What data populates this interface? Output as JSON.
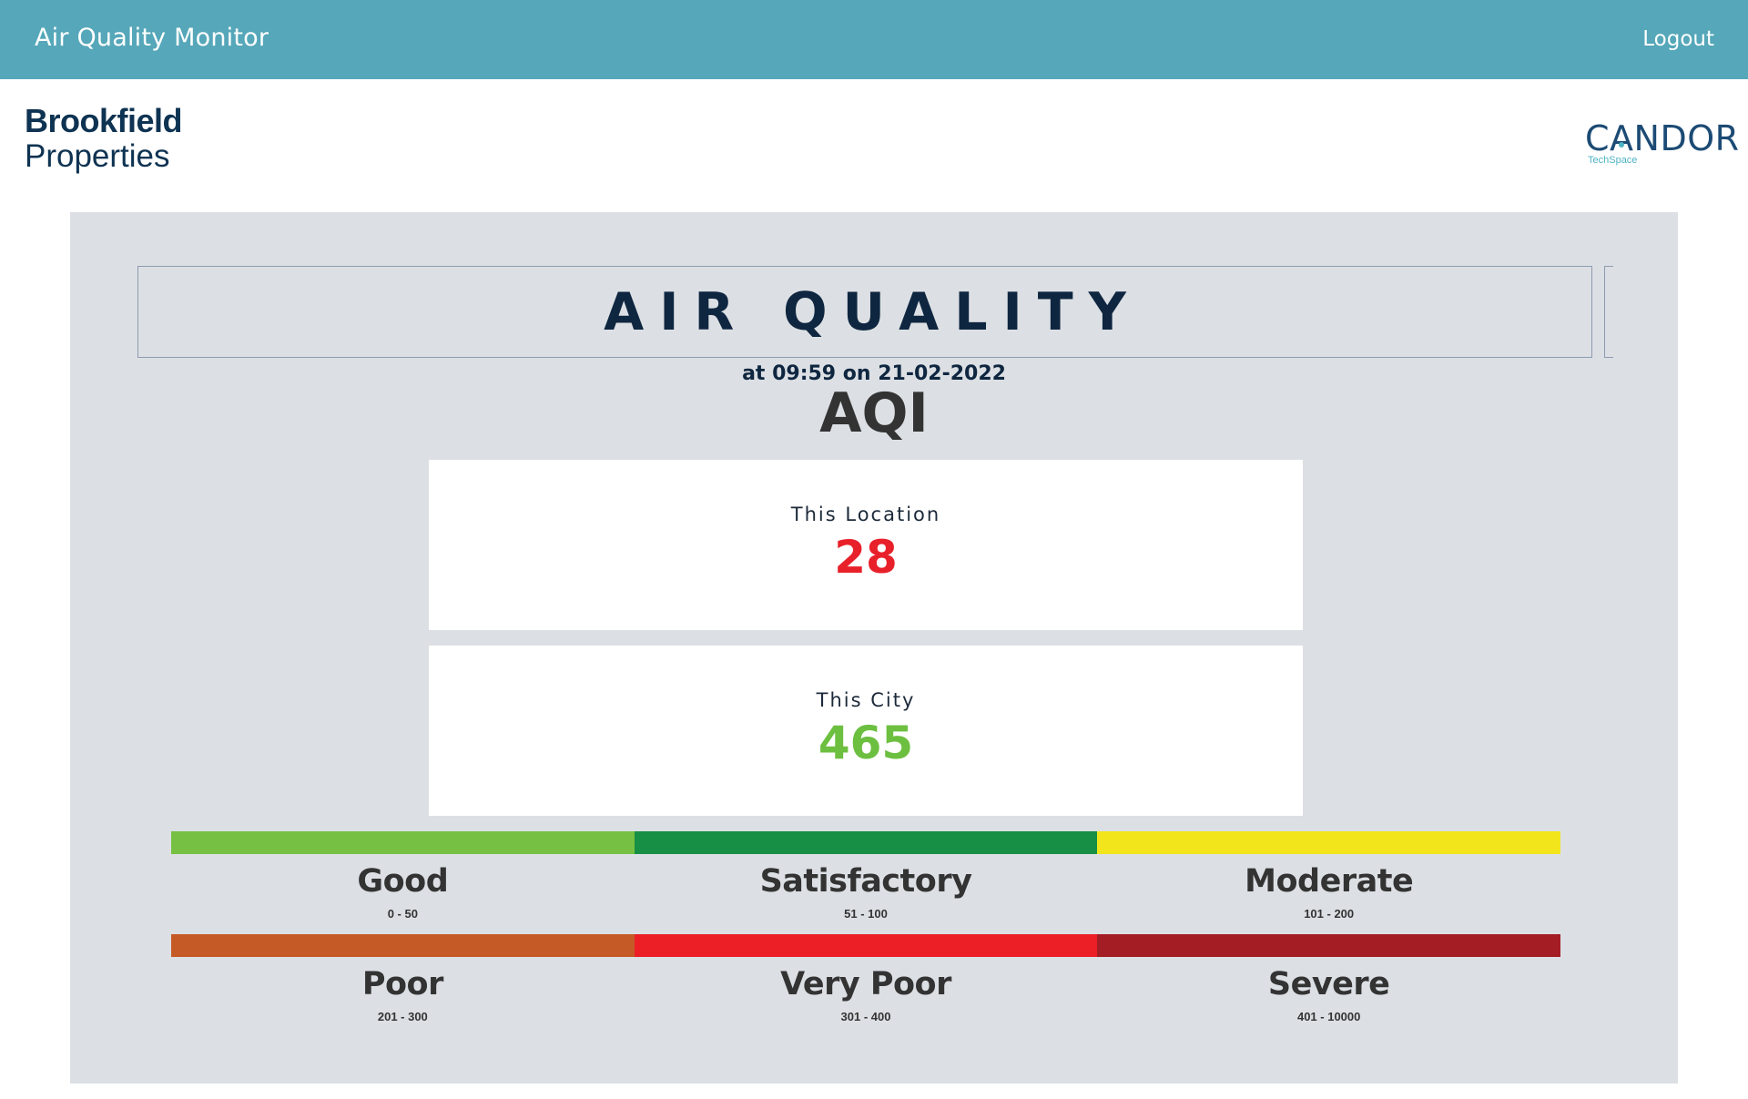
{
  "header": {
    "app_title": "Air Quality Monitor",
    "logout_label": "Logout",
    "background_color": "#55a7b9"
  },
  "brand_left": {
    "line1": "Brookfield",
    "line2": "Properties"
  },
  "brand_right": {
    "name_part1": "C",
    "name_accent": "A",
    "name_part2": "NDOR",
    "tagline": "TechSpace"
  },
  "main": {
    "title": "AIR QUALITY",
    "timestamp": "at 09:59 on 21-02-2022",
    "aqi_heading": "AQI",
    "cards": [
      {
        "label": "This Location",
        "value": "28",
        "color": "#e8202a"
      },
      {
        "label": "This City",
        "value": "465",
        "color": "#6cbf3f"
      }
    ],
    "scale": [
      {
        "name": "Good",
        "range": "0 - 50",
        "color": "#76c043"
      },
      {
        "name": "Satisfactory",
        "range": "51 - 100",
        "color": "#178f44"
      },
      {
        "name": "Moderate",
        "range": "101 - 200",
        "color": "#f2e51b"
      },
      {
        "name": "Poor",
        "range": "201 - 300",
        "color": "#c55a27"
      },
      {
        "name": "Very Poor",
        "range": "301 - 400",
        "color": "#ec1f27"
      },
      {
        "name": "Severe",
        "range": "401 - 10000",
        "color": "#a51d24"
      }
    ]
  }
}
